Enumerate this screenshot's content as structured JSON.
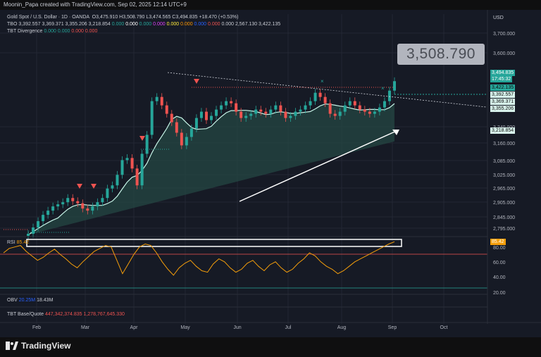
{
  "header": {
    "text": "Moonin_Papa created with TradingView.com, Sep 02, 2025 12:14 UTC+9"
  },
  "legend": {
    "symbol": "Gold Spot / U.S. Dollar · 1D · OANDA",
    "ohlc": "O3,475.910 H3,508.790 L3,474.565 C3,494.835 +18.470 (+0.53%)",
    "tbo_label": "TBO",
    "tbo_values": [
      "3,392.557",
      "3,369.371",
      "3,355.206",
      "3,218.854",
      "0.000",
      "0.000",
      "0.000",
      "0.000",
      "0.000",
      "0.000",
      "0.000",
      "0.000",
      "0.000",
      "2,567.130",
      "3,422.135"
    ],
    "tbt_div_label": "TBT Divergence",
    "tbt_div_values": [
      "0.000",
      "0.000",
      "0.000",
      "0.000"
    ],
    "rsi_label": "RSI",
    "rsi_value": "85.42",
    "obv_label": "OBV",
    "obv_values": [
      "20.25M",
      "18.43M"
    ],
    "tbt_base_label": "TBT Base/Quote",
    "tbt_base_values": [
      "447,342,374.835",
      "1,278,767,645.330"
    ]
  },
  "currency": "USD",
  "big_price": "3,508.790",
  "price_tags": {
    "last": "3,494.835",
    "countdown": "17:45:32",
    "green": "3,422.135",
    "a": "3,392.557",
    "b": "3,369.371",
    "c": "3,355.206",
    "d": "3,218.854"
  },
  "rsi_tag": "85.42",
  "brand": "TradingView",
  "colors": {
    "up": "#26a69a",
    "down": "#ef5350",
    "line": "#c7f5e8",
    "rsi": "#f59e0b"
  },
  "chart_data": {
    "type": "line",
    "x_ticks": [
      "Feb",
      "Mar",
      "Apr",
      "May",
      "Jun",
      "Jul",
      "Aug",
      "Sep",
      "Oct"
    ],
    "y_ticks": [
      "3,700.000",
      "3,600.000",
      "3,240.000",
      "3,160.000",
      "3,085.000",
      "3,025.000",
      "2,965.000",
      "2,905.000",
      "2,845.000",
      "2,795.000"
    ],
    "rsi_ticks": [
      "80.00",
      "60.00",
      "40.00",
      "20.00"
    ],
    "series": [
      {
        "name": "Close",
        "values": [
          2770,
          2800,
          2830,
          2860,
          2880,
          2900,
          2910,
          2920,
          2940,
          2925,
          2915,
          2890,
          2880,
          2900,
          2920,
          2940,
          2985,
          3000,
          3050,
          3120,
          3130,
          3080,
          3000,
          3150,
          3240,
          3400,
          3420,
          3380,
          3340,
          3300,
          3250,
          3190,
          3230,
          3270,
          3320,
          3350,
          3310,
          3330,
          3360,
          3380,
          3400,
          3390,
          3350,
          3320,
          3330,
          3340,
          3360,
          3350,
          3340,
          3360,
          3380,
          3350,
          3320,
          3330,
          3350,
          3360,
          3380,
          3400,
          3440,
          3420,
          3390,
          3340,
          3330,
          3350,
          3380,
          3400,
          3380,
          3360,
          3350,
          3340,
          3350,
          3370,
          3400,
          3450,
          3495
        ]
      }
    ],
    "rsi": [
      70,
      76,
      78,
      80,
      72,
      66,
      60,
      64,
      70,
      75,
      68,
      62,
      55,
      50,
      58,
      65,
      72,
      76,
      80,
      78,
      60,
      42,
      55,
      68,
      78,
      82,
      80,
      70,
      58,
      48,
      40,
      50,
      56,
      60,
      52,
      46,
      44,
      55,
      62,
      58,
      50,
      44,
      48,
      56,
      60,
      52,
      46,
      54,
      58,
      50,
      44,
      48,
      56,
      62,
      70,
      66,
      58,
      52,
      48,
      42,
      46,
      52,
      58,
      62,
      66,
      70,
      74,
      78,
      82,
      85
    ]
  }
}
